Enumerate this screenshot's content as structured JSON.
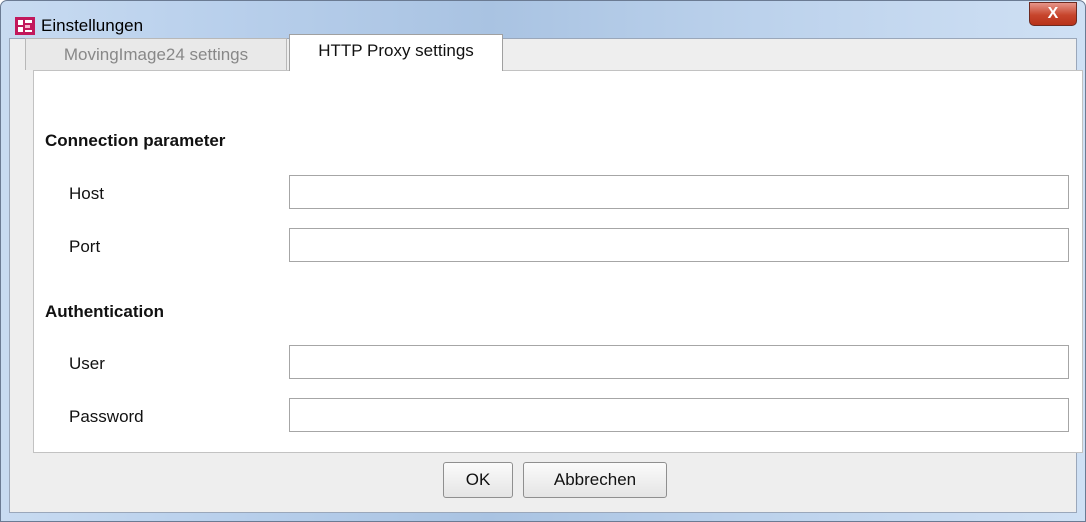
{
  "window": {
    "title": "Einstellungen",
    "close_label": "X"
  },
  "tabs": [
    {
      "label": "MovingImage24 settings",
      "active": false
    },
    {
      "label": "HTTP Proxy settings",
      "active": true
    }
  ],
  "connection": {
    "heading": "Connection parameter",
    "host_label": "Host",
    "host_value": "",
    "port_label": "Port",
    "port_value": ""
  },
  "authentication": {
    "heading": "Authentication",
    "user_label": "User",
    "user_value": "",
    "password_label": "Password",
    "password_value": ""
  },
  "buttons": {
    "ok_label": "OK",
    "cancel_label": "Abbrechen"
  }
}
